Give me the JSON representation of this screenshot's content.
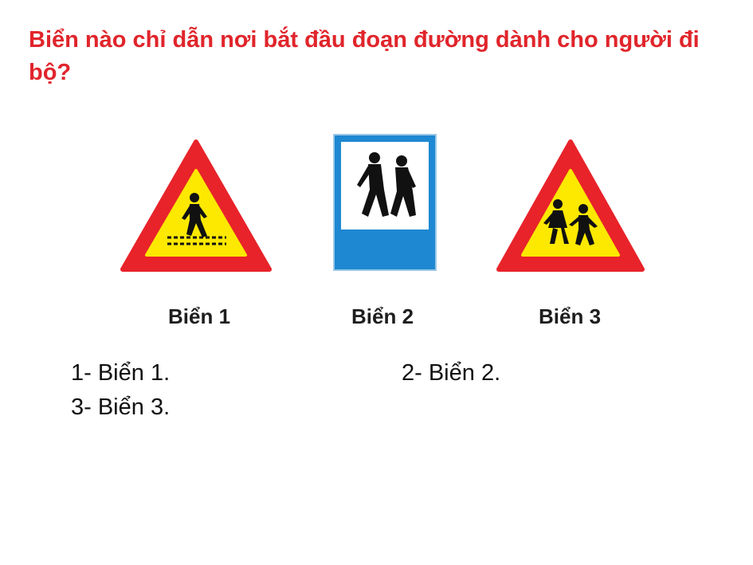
{
  "question": {
    "text": "Biển nào chỉ dẫn nơi bắt đầu đoạn đường dành cho người đi bộ?",
    "color": "#e0252b"
  },
  "signs": [
    {
      "label": "Biển 1",
      "icon": "pedestrian-crossing-warning-icon"
    },
    {
      "label": "Biển 2",
      "icon": "pedestrian-path-info-icon"
    },
    {
      "label": "Biển 3",
      "icon": "children-crossing-warning-icon"
    }
  ],
  "options": [
    {
      "label": "1- Biển 1."
    },
    {
      "label": "2- Biển 2."
    },
    {
      "label": "3- Biển 3."
    }
  ],
  "colors": {
    "warning_red": "#e8232a",
    "warning_yellow": "#fde800",
    "info_blue": "#1e88d2",
    "text_dark": "#111111"
  }
}
